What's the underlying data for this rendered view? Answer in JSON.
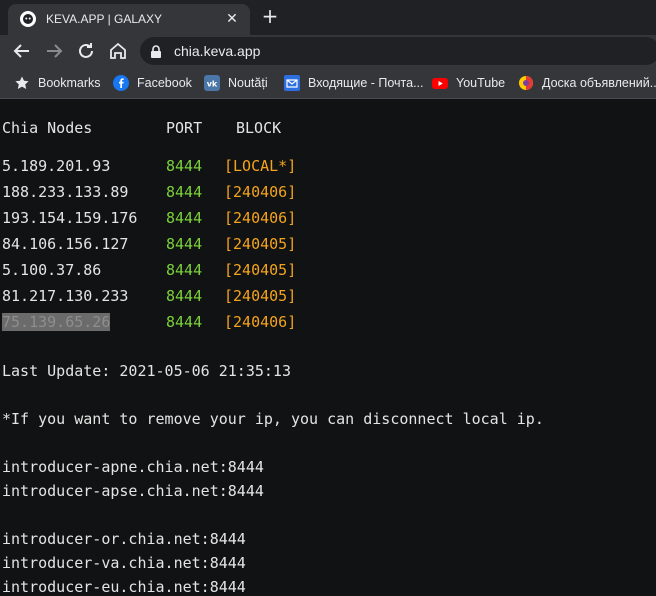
{
  "browser": {
    "tab_title": "KEVA.APP | GALAXY",
    "tab_close": "✕",
    "new_tab": "+",
    "url": "chia.keva.app"
  },
  "bookmarks": [
    {
      "label": "Bookmarks",
      "icon": "star-icon"
    },
    {
      "label": "Facebook",
      "icon": "facebook-icon"
    },
    {
      "label": "Noutăți",
      "icon": "vk-icon"
    },
    {
      "label": "Входящие - Почта...",
      "icon": "mail-icon"
    },
    {
      "label": "YouTube",
      "icon": "youtube-icon"
    },
    {
      "label": "Доска объявлений...",
      "icon": "board-icon"
    }
  ],
  "table": {
    "headers": {
      "nodes": "Chia Nodes",
      "port": "PORT",
      "block": "BLOCK"
    },
    "rows": [
      {
        "ip": "5.189.201.93",
        "port": "8444",
        "block": "[LOCAL*]"
      },
      {
        "ip": "188.233.133.89",
        "port": "8444",
        "block": "[240406]"
      },
      {
        "ip": "193.154.159.176",
        "port": "8444",
        "block": "[240406]"
      },
      {
        "ip": "84.106.156.127",
        "port": "8444",
        "block": "[240405]"
      },
      {
        "ip": "5.100.37.86",
        "port": "8444",
        "block": "[240405]"
      },
      {
        "ip": "81.217.130.233",
        "port": "8444",
        "block": "[240405]"
      },
      {
        "ip": "75.139.65.26",
        "port": "8444",
        "block": "[240406]"
      }
    ]
  },
  "last_update": "Last Update: 2021-05-06 21:35:13",
  "note": "*If you want to remove your ip, you can disconnect local ip.",
  "introducers": [
    "introducer-apne.chia.net:8444",
    "introducer-apse.chia.net:8444",
    "introducer-or.chia.net:8444",
    "introducer-va.chia.net:8444",
    "introducer-eu.chia.net:8444"
  ],
  "colors": {
    "port": "#7cd13a",
    "block": "#f4a41c",
    "background": "#111213"
  }
}
